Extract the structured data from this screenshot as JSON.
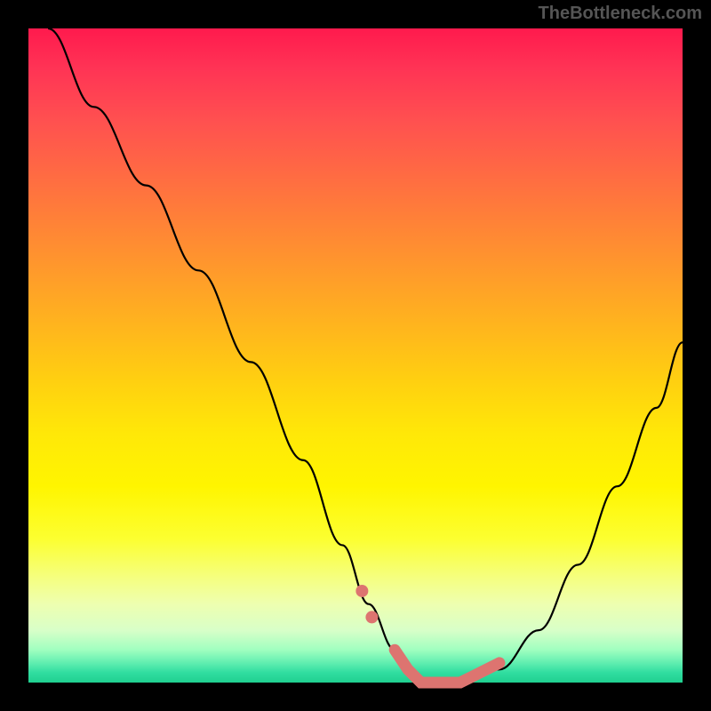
{
  "watermark": "TheBottleneck.com",
  "chart_data": {
    "type": "line",
    "title": "",
    "xlabel": "",
    "ylabel": "",
    "ylim": [
      0,
      100
    ],
    "xlim": [
      0,
      100
    ],
    "series": [
      {
        "name": "bottleneck-curve",
        "x": [
          3,
          10,
          18,
          26,
          34,
          42,
          48,
          52,
          56,
          58,
          60,
          62,
          66,
          72,
          78,
          84,
          90,
          96,
          100
        ],
        "y": [
          100,
          88,
          76,
          63,
          49,
          34,
          21,
          12,
          5,
          2,
          0,
          0,
          0,
          2,
          8,
          18,
          30,
          42,
          52
        ]
      }
    ],
    "optimal_band": {
      "x": [
        56,
        58,
        60,
        62,
        64,
        66,
        68,
        70,
        72
      ],
      "y": [
        5,
        2,
        0,
        0,
        0,
        0,
        1,
        2,
        3
      ]
    },
    "markers": {
      "x": [
        51,
        52.5
      ],
      "y": [
        14,
        10
      ]
    },
    "gradient_meaning": "red_top_is_bad_green_bottom_is_good"
  }
}
